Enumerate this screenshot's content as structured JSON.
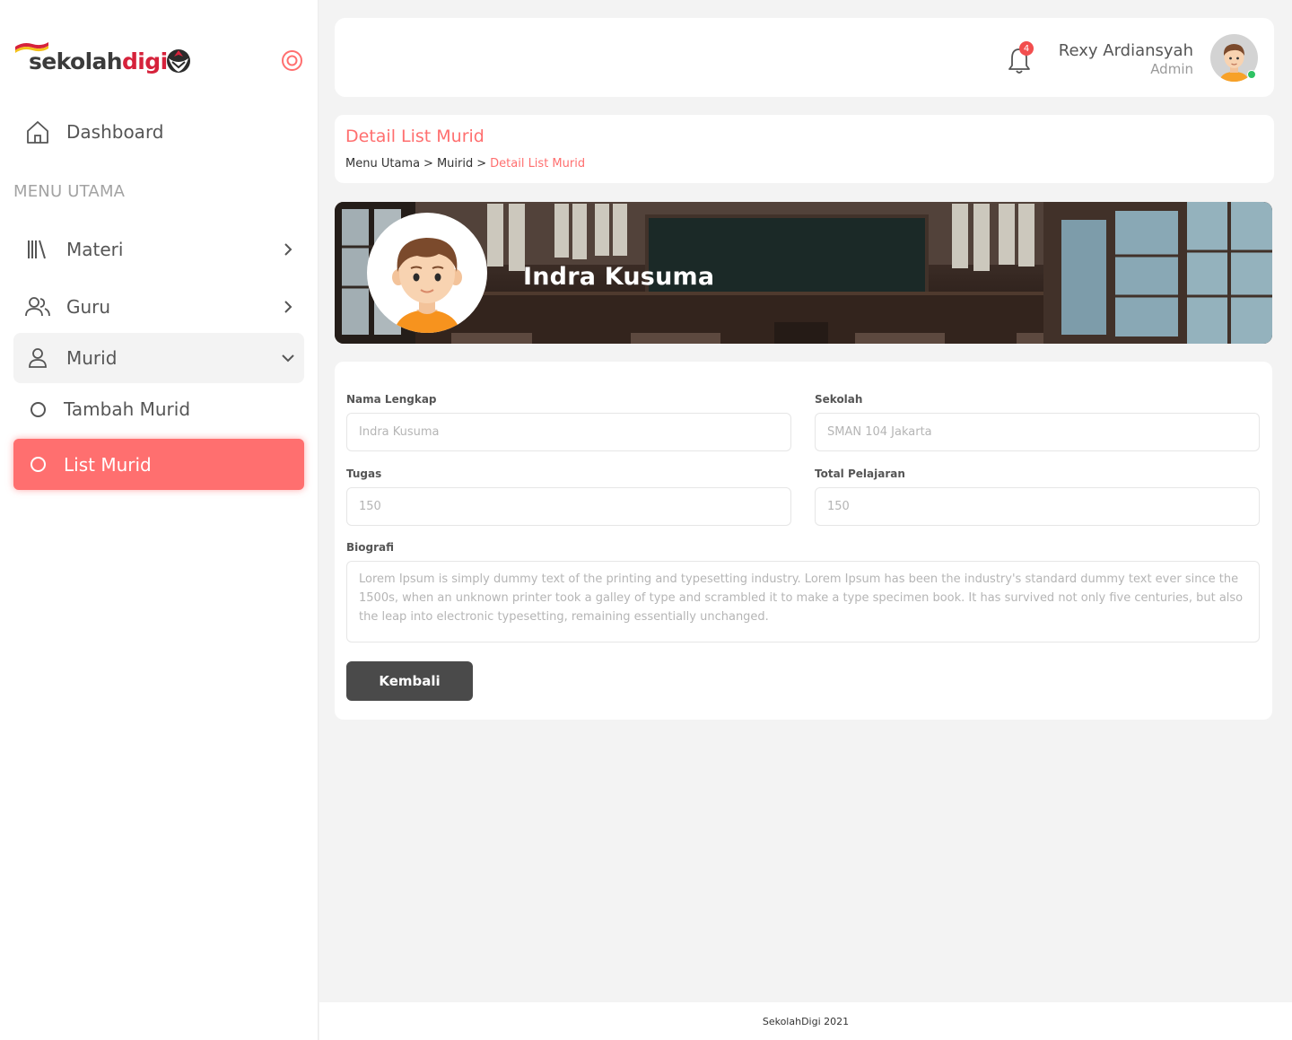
{
  "app": {
    "logo_text_main": "sekolah",
    "logo_text_accent": "digi"
  },
  "sidebar": {
    "dashboard": "Dashboard",
    "section_title": "MENU UTAMA",
    "items": [
      {
        "label": "Materi",
        "icon": "library-icon"
      },
      {
        "label": "Guru",
        "icon": "users-icon"
      },
      {
        "label": "Murid",
        "icon": "user-icon"
      }
    ],
    "sub_items": [
      {
        "label": "Tambah Murid"
      },
      {
        "label": "List Murid"
      }
    ]
  },
  "header": {
    "notification_count": "4",
    "user_name": "Rexy Ardiansyah",
    "user_role": "Admin"
  },
  "page": {
    "title": "Detail List Murid",
    "breadcrumb": [
      "Menu Utama",
      "Muirid",
      "Detail List Murid"
    ],
    "breadcrumb_sep": ">"
  },
  "profile": {
    "name": "Indra Kusuma"
  },
  "form": {
    "nama_label": "Nama Lengkap",
    "nama_value": "Indra Kusuma",
    "sekolah_label": "Sekolah",
    "sekolah_value": "SMAN 104 Jakarta",
    "tugas_label": "Tugas",
    "tugas_value": "150",
    "total_label": "Total Pelajaran",
    "total_value": "150",
    "bio_label": "Biografi",
    "bio_value": "Lorem Ipsum is simply dummy text of the printing and typesetting industry. Lorem Ipsum has been the industry's standard dummy text ever since the 1500s, when an unknown printer took a galley of type and scrambled it to make a type specimen book. It has survived not only five centuries, but also the leap into electronic typesetting, remaining essentially unchanged.",
    "back_button": "Kembali"
  },
  "footer": {
    "text": "SekolahDigi 2021"
  },
  "colors": {
    "accent": "#ff6f6f",
    "brand_red": "#d6223b",
    "button_dark": "#4a4a4a",
    "online": "#2ec263"
  }
}
